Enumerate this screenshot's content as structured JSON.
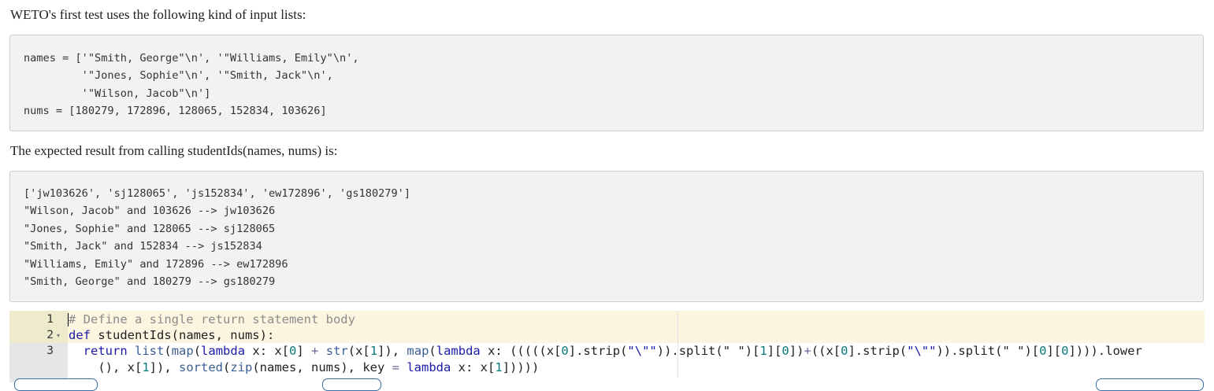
{
  "intro_text": "WETO's first test uses the following kind of input lists:",
  "input_code_lines": [
    "names = ['\"Smith, George\"\\n', '\"Williams, Emily\"\\n',",
    "         '\"Jones, Sophie\"\\n', '\"Smith, Jack\"\\n',",
    "         '\"Wilson, Jacob\"\\n']",
    "nums = [180279, 172896, 128065, 152834, 103626]"
  ],
  "expected_text": "The expected result from calling studentIds(names, nums) is:",
  "expected_code_lines": [
    "['jw103626', 'sj128065', 'js152834', 'ew172896', 'gs180279']",
    "\"Wilson, Jacob\" and 103626 --> jw103626",
    "\"Jones, Sophie\" and 128065 --> sj128065",
    "\"Smith, Jack\" and 152834 --> js152834",
    "\"Williams, Emily\" and 172896 --> ew172896",
    "\"Smith, George\" and 180279 --> gs180279"
  ],
  "editor": {
    "line_numbers": [
      "1",
      "2",
      "3"
    ],
    "fold_marker": "▾",
    "line1": [
      {
        "text": "# Define a single return statement body",
        "cls": "t-comment"
      }
    ],
    "line2": [
      {
        "text": "def",
        "cls": "t-kw"
      },
      {
        "text": " studentIds(names, nums):",
        "cls": "t-plain"
      }
    ],
    "line3a": [
      {
        "text": "  ",
        "cls": "t-plain"
      },
      {
        "text": "return",
        "cls": "t-kw"
      },
      {
        "text": " ",
        "cls": "t-plain"
      },
      {
        "text": "list",
        "cls": "t-func"
      },
      {
        "text": "(",
        "cls": "t-plain"
      },
      {
        "text": "map",
        "cls": "t-func"
      },
      {
        "text": "(",
        "cls": "t-plain"
      },
      {
        "text": "lambda",
        "cls": "t-kw"
      },
      {
        "text": " x: x[",
        "cls": "t-plain"
      },
      {
        "text": "0",
        "cls": "t-num"
      },
      {
        "text": "] ",
        "cls": "t-plain"
      },
      {
        "text": "+",
        "cls": "t-op"
      },
      {
        "text": " ",
        "cls": "t-plain"
      },
      {
        "text": "str",
        "cls": "t-func"
      },
      {
        "text": "(x[",
        "cls": "t-plain"
      },
      {
        "text": "1",
        "cls": "t-num"
      },
      {
        "text": "]), ",
        "cls": "t-plain"
      },
      {
        "text": "map",
        "cls": "t-func"
      },
      {
        "text": "(",
        "cls": "t-plain"
      },
      {
        "text": "lambda",
        "cls": "t-kw"
      },
      {
        "text": " x: (((((x[",
        "cls": "t-plain"
      },
      {
        "text": "0",
        "cls": "t-num"
      },
      {
        "text": "].strip(",
        "cls": "t-plain"
      },
      {
        "text": "\"\\\"\"",
        "cls": "t-str"
      },
      {
        "text": ")).split(",
        "cls": "t-plain"
      },
      {
        "text": "\" \"",
        "cls": "t-plain"
      },
      {
        "text": ")[",
        "cls": "t-plain"
      },
      {
        "text": "1",
        "cls": "t-num"
      },
      {
        "text": "][",
        "cls": "t-plain"
      },
      {
        "text": "0",
        "cls": "t-num"
      },
      {
        "text": "])",
        "cls": "t-plain"
      },
      {
        "text": "+",
        "cls": "t-op"
      },
      {
        "text": "((x[",
        "cls": "t-plain"
      },
      {
        "text": "0",
        "cls": "t-num"
      },
      {
        "text": "].strip(",
        "cls": "t-plain"
      },
      {
        "text": "\"\\\"\"",
        "cls": "t-str"
      },
      {
        "text": ")).split(",
        "cls": "t-plain"
      },
      {
        "text": "\" \"",
        "cls": "t-plain"
      },
      {
        "text": ")[",
        "cls": "t-plain"
      },
      {
        "text": "0",
        "cls": "t-num"
      },
      {
        "text": "][",
        "cls": "t-plain"
      },
      {
        "text": "0",
        "cls": "t-num"
      },
      {
        "text": "]))).lower",
        "cls": "t-plain"
      }
    ],
    "line3b": [
      {
        "text": "    (), x[",
        "cls": "t-plain"
      },
      {
        "text": "1",
        "cls": "t-num"
      },
      {
        "text": "]), ",
        "cls": "t-plain"
      },
      {
        "text": "sorted",
        "cls": "t-func"
      },
      {
        "text": "(",
        "cls": "t-plain"
      },
      {
        "text": "zip",
        "cls": "t-func"
      },
      {
        "text": "(names, nums), key ",
        "cls": "t-plain"
      },
      {
        "text": "=",
        "cls": "t-op"
      },
      {
        "text": " ",
        "cls": "t-plain"
      },
      {
        "text": "lambda",
        "cls": "t-kw"
      },
      {
        "text": " x: x[",
        "cls": "t-plain"
      },
      {
        "text": "1",
        "cls": "t-num"
      },
      {
        "text": "]))))",
        "cls": "t-plain"
      }
    ]
  }
}
